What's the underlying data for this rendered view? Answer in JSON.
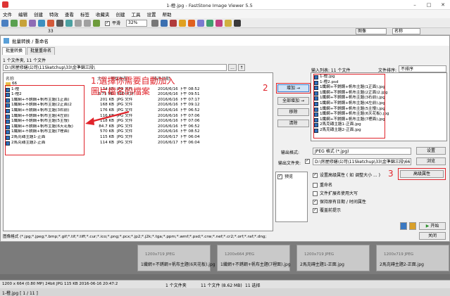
{
  "app": {
    "title": "1-橙.jpg - FastStone Image Viewer 5.5"
  },
  "menu": [
    "文件",
    "编辑",
    "创建",
    "特效",
    "查看",
    "标签",
    "收藏夹",
    "创建",
    "工具",
    "设置",
    "帮助"
  ],
  "toolbar": {
    "fit_label": "平滑",
    "zoom": "32%",
    "filter": "图像",
    "sort": "名称",
    "folder_num": "33"
  },
  "dialog": {
    "title": "批量转换 / 重命名",
    "tabs": [
      "批量转换",
      "批量重命名"
    ],
    "left_count": "1 个文件夹, 11 个文件",
    "path": "D:\\房屋修繕\\公司\\11Sketchup\\33\\金準錦三段\\",
    "columns": {
      "name": "名称",
      "size": "大小",
      "type": "项目类型",
      "date": "修改日期"
    },
    "files": [
      {
        "name": "66",
        "size": "",
        "type": "",
        "date": "",
        "folder": true
      },
      {
        "name": "1-橙",
        "size": "114 KB",
        "type": "JPG 文件",
        "date": "2016/6/16 下午 08:52"
      },
      {
        "name": "1-橙2",
        "size": "6.75 MB",
        "type": "PSD 文件",
        "date": "2016/6/16 下午 09:51"
      },
      {
        "name": "1纖網+不銹鋼+帆布主題(1正面)",
        "size": "201 KB",
        "type": "JPG 文件",
        "date": "2016/6/16 下午 07:17"
      },
      {
        "name": "1纖網+不銹鋼+帆布主題(2正面)2",
        "size": "168 KB",
        "type": "JPG 文件",
        "date": "2016/6/16 下午 09:12"
      },
      {
        "name": "1纖網+不銹鋼+帆布主題(3右前)",
        "size": "176 KB",
        "type": "JPG 文件",
        "date": "2016/6/16 下午 06:52"
      },
      {
        "name": "1纖網+不銹鋼+帆布主題(4左前)",
        "size": "116 KB",
        "type": "JPG 文件",
        "date": "2016/6/16 下午 07:06"
      },
      {
        "name": "1纖網+不銹鋼+帆布主題(5主慢)",
        "size": "118 KB",
        "type": "JPG 文件",
        "date": "2016/6/16 下午 07:06"
      },
      {
        "name": "1纖網+不銹鋼+帆布主題(6天花板)",
        "size": "84.7 KB",
        "type": "JPG 文件",
        "date": "2016/6/16 下午 06:52"
      },
      {
        "name": "1纖網+不銹鋼+帆布主題(7裡面)",
        "size": "570 KB",
        "type": "JPG 文件",
        "date": "2016/6/16 下午 08:52"
      },
      {
        "name": "2馬克磚主題1-正面",
        "size": "115 KB",
        "type": "JPG 文件",
        "date": "2016/6/17 下午 06:04"
      },
      {
        "name": "2馬克磚主題2-正面",
        "size": "114 KB",
        "type": "JPG 文件",
        "date": "2016/6/17 下午 06:04"
      }
    ],
    "filter_text": "图像格式 (*.jpg;*.jpeg;*.bmp;*.gif;*.tif;*.tiff;*.cur;*.ico;*.png;*.pcx;*.jp2;*.j2k;*.tga;*.ppm;*.wmf;*.psd;*.crw;*.nef;*.cr2;*.orf;*.raf;*.dng;",
    "buttons": {
      "add": "增加 →",
      "add_all": "全部增加 →",
      "remove": "移除",
      "clear": "清除"
    },
    "right_header": "输入列表: 11 个文件",
    "sort_label": "文件排序:",
    "sort_value": "不排序",
    "input_list": [
      "1-橙.jpg",
      "1-橙2.psd",
      "1纖網+不銹鋼+帆布主題(1正面).jpg",
      "1纖網+不銹鋼+帆布主題(2正面)2.jpg",
      "1纖網+不銹鋼+帆布主題(3右前).jpg",
      "1纖網+不銹鋼+帆布主題(4左前).jpg",
      "1纖網+不銹鋼+帆布主題(5主慢).jpg",
      "1纖網+不銹鋼+帆布主題(6天花板).jpg",
      "1纖網+不銹鋼+帆布主題(7裡面).jpg",
      "2馬克磚主題1-正面.jpg",
      "2馬克磚主題2-正面.jpg"
    ],
    "output_format_label": "输出格式:",
    "output_format": "JPEG 格式 (*.jpg)",
    "settings_btn": "设置",
    "output_folder_label": "输出文件夹:",
    "output_folder": "D:\\房屋修繕\\公司\\11Sketchup\\33\\金準錦三段\\66",
    "browse_btn": "浏览",
    "preview_label": "预览",
    "opt_advanced": "设置高级属性 ( 如 调整大小 ... )",
    "advanced_btn": "高级属性",
    "opt_rename": "重命名",
    "opt_ext_case": "文件扩展名使用大写",
    "opt_keep_date": "保持原有日期 / 时间属性",
    "opt_overwrite": "覆盖前提示",
    "start_btn": "开始",
    "close_btn": "关闭"
  },
  "annotations": {
    "main_line1": "1.選擇你需要自動加入",
    "main_line2": "圖片檔名的檔案",
    "step2": "2",
    "step3": "3"
  },
  "thumbs": [
    {
      "meta": "1200x719    JPEG",
      "caption": "1纖網+不銹鋼+帆布主題(6天花板).jpg"
    },
    {
      "meta": "1200x664    JPEG",
      "caption": "1纖網+不銹鋼+帆布主題(7裡面).jpg"
    },
    {
      "meta": "1200x719    JPEG",
      "caption": "2馬克磚主題1-正面.jpg"
    },
    {
      "meta": "1200x719    JPEG",
      "caption": "2馬克磚主題2-正面.jpg"
    }
  ],
  "status": {
    "info": "1200 x 664 (0.80 MP)  24bit  JPG  115 KB  2016-06-16 20:47:2",
    "folders": "1 个文件夹",
    "files": "11 个文件 (8.62 MB)",
    "selected": "11 选择",
    "file": "1-橙.jpg [ 1 / 11 ]"
  },
  "colors": {
    "annotation_red": "#e0242b",
    "selection_blue": "#3c7fd3"
  }
}
